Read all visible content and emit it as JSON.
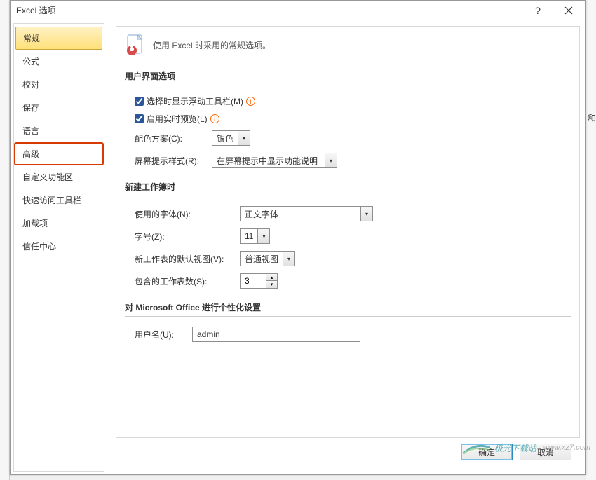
{
  "titlebar": {
    "title": "Excel 选项"
  },
  "sidebar": {
    "items": [
      {
        "label": "常规"
      },
      {
        "label": "公式"
      },
      {
        "label": "校对"
      },
      {
        "label": "保存"
      },
      {
        "label": "语言"
      },
      {
        "label": "高级"
      },
      {
        "label": "自定义功能区"
      },
      {
        "label": "快速访问工具栏"
      },
      {
        "label": "加载项"
      },
      {
        "label": "信任中心"
      }
    ]
  },
  "header": {
    "text": "使用 Excel 时采用的常规选项。"
  },
  "sections": {
    "ui": {
      "title": "用户界面选项",
      "mini_toolbar": "选择时显示浮动工具栏(M)",
      "live_preview": "启用实时预览(L)",
      "color_scheme_label": "配色方案(C):",
      "color_scheme_value": "银色",
      "screentip_label": "屏幕提示样式(R):",
      "screentip_value": "在屏幕提示中显示功能说明"
    },
    "workbook": {
      "title": "新建工作簿时",
      "font_label": "使用的字体(N):",
      "font_value": "正文字体",
      "size_label": "字号(Z):",
      "size_value": "11",
      "view_label": "新工作表的默认视图(V):",
      "view_value": "普通视图",
      "sheets_label": "包含的工作表数(S):",
      "sheets_value": "3"
    },
    "personalize": {
      "title": "对 Microsoft Office 进行个性化设置",
      "username_label": "用户名(U):",
      "username_value": "admin"
    }
  },
  "footer": {
    "ok": "确定",
    "cancel": "取消"
  },
  "watermark": {
    "name": "极光下载站",
    "url": "www.xz7.com"
  },
  "bg_snip": "和"
}
